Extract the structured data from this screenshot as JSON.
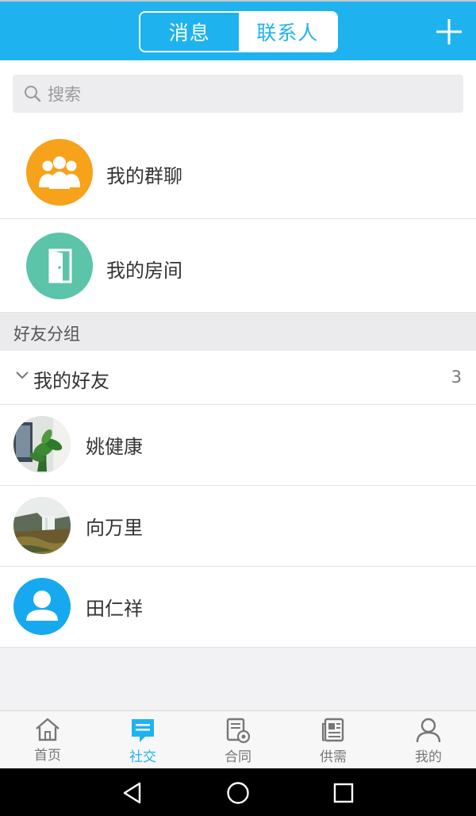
{
  "header": {
    "tabs": [
      {
        "label": "消息",
        "active": false
      },
      {
        "label": "联系人",
        "active": true
      }
    ],
    "add_icon": "plus-icon",
    "accent": "#1eb3ef"
  },
  "search": {
    "placeholder": "搜索",
    "icon": "search-icon"
  },
  "shortcuts": [
    {
      "label": "我的群聊",
      "icon": "group-icon",
      "color": "#f7a21b"
    },
    {
      "label": "我的房间",
      "icon": "door-icon",
      "color": "#5cc4a8"
    }
  ],
  "section": {
    "title": "好友分组"
  },
  "group": {
    "name": "我的好友",
    "count": "3",
    "expanded": true
  },
  "friends": [
    {
      "name": "姚健康",
      "avatar": "plant-photo-avatar"
    },
    {
      "name": "向万里",
      "avatar": "waterfall-photo-avatar"
    },
    {
      "name": "田仁祥",
      "avatar": "default-user-avatar"
    }
  ],
  "tabbar": {
    "items": [
      {
        "label": "首页",
        "icon": "home-icon",
        "active": false
      },
      {
        "label": "社交",
        "icon": "chat-icon",
        "active": true
      },
      {
        "label": "合同",
        "icon": "contract-icon",
        "active": false
      },
      {
        "label": "供需",
        "icon": "news-icon",
        "active": false
      },
      {
        "label": "我的",
        "icon": "person-icon",
        "active": false
      }
    ]
  },
  "system_nav": [
    "back-icon",
    "home-circle-icon",
    "recents-icon"
  ]
}
